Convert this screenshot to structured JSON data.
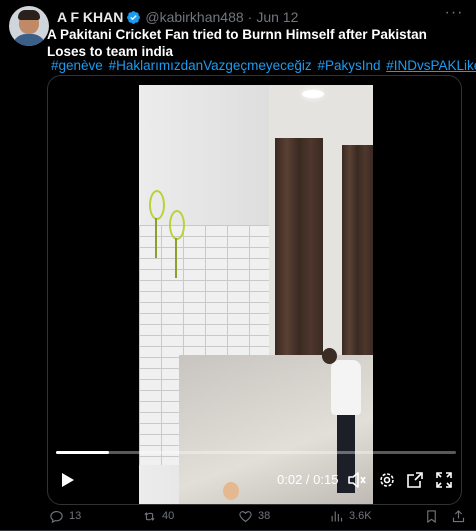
{
  "author": {
    "name": "A F KHAN",
    "handle": "@kabirkhan488",
    "separator": "·",
    "date": "Jun 12"
  },
  "tweet": {
    "text": "A Pakitani Cricket Fan tried to Burnn Himself after Pakistan Loses to team india",
    "hashtags": [
      "#genève",
      "#HaklarımızdanVazgeçmeyeceğiz",
      "#PakysInd",
      "#INDvsPAKLike"
    ]
  },
  "video": {
    "time_display": "0:02 / 0:15",
    "progress": 0.133
  },
  "actions": {
    "replies": "13",
    "reposts": "40",
    "likes": "38",
    "views": "3.6K"
  },
  "colors": {
    "accent": "#1d9bf0",
    "muted": "#71767b",
    "background": "#000000"
  },
  "icons": [
    "verified-badge-icon",
    "more-icon",
    "play-icon",
    "volume-icon",
    "settings-icon",
    "pip-icon",
    "fullscreen-icon",
    "reply-icon",
    "repost-icon",
    "like-icon",
    "views-icon",
    "bookmark-icon",
    "share-icon"
  ]
}
